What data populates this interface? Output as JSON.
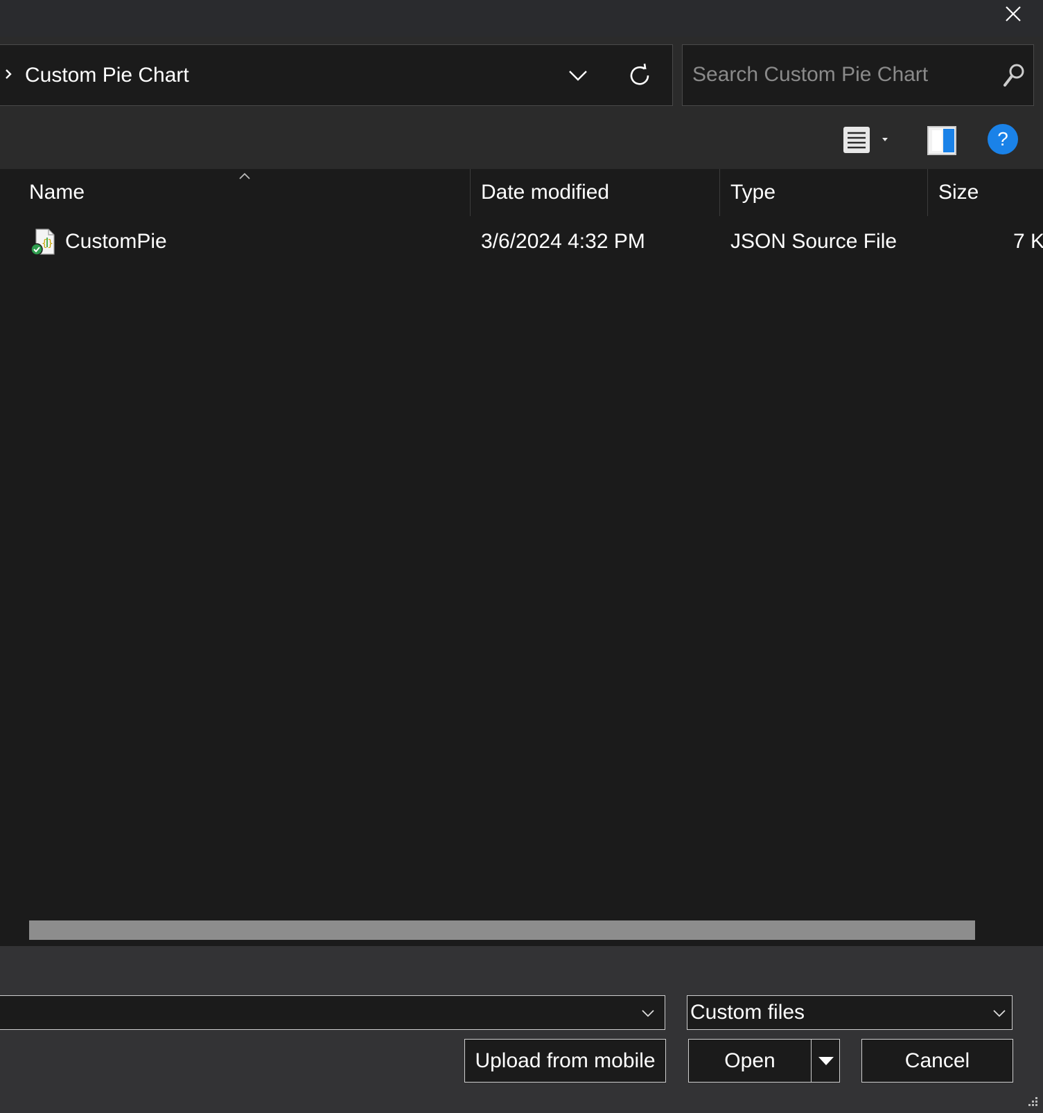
{
  "window": {
    "close_label": "Close"
  },
  "address": {
    "breadcrumb": "Custom Pie Chart"
  },
  "search": {
    "placeholder": "Search Custom Pie Chart",
    "value": ""
  },
  "toolbar": {
    "help_label": "?"
  },
  "file_list": {
    "columns": [
      "Name",
      "Date modified",
      "Type",
      "Size"
    ],
    "sort_column": "Name",
    "rows": [
      {
        "name": "CustomPie",
        "date_modified": "3/6/2024 4:32 PM",
        "type": "JSON Source File",
        "size": "7 K",
        "icon": "json-file-icon"
      }
    ]
  },
  "bottom": {
    "filename_value": "",
    "filetype_selected": "Custom files",
    "upload_label": "Upload from mobile",
    "open_label": "Open",
    "cancel_label": "Cancel"
  },
  "colors": {
    "background": "#1b1b1b",
    "panel": "#2b2b2b",
    "bottom_panel": "#333335",
    "accent": "#1a82e8",
    "scroll_thumb": "#8d8d8d"
  }
}
